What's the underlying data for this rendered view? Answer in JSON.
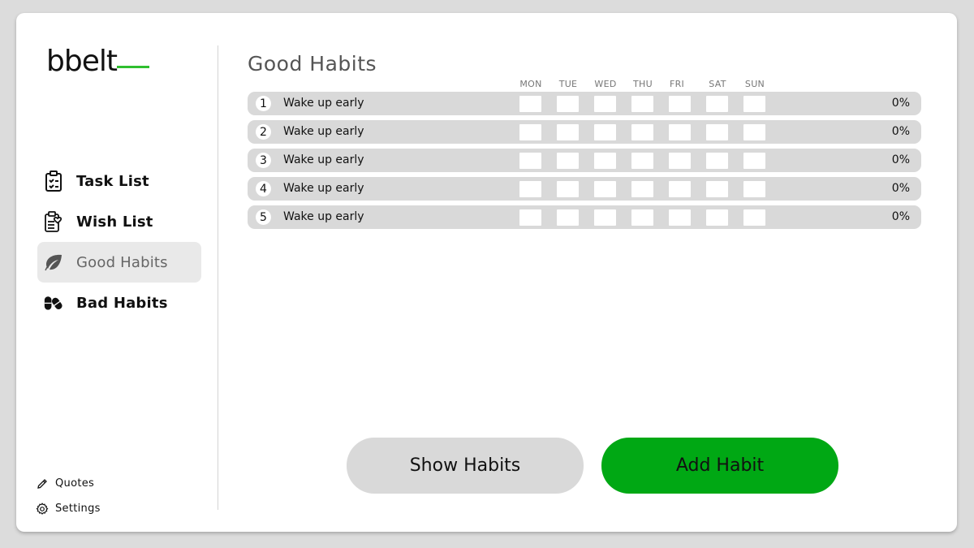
{
  "app": {
    "logo_text": "bbelt"
  },
  "sidebar": {
    "items": [
      {
        "label": "Task List",
        "icon": "clipboard-check-icon",
        "active": false
      },
      {
        "label": "Wish List",
        "icon": "clipboard-heart-icon",
        "active": false
      },
      {
        "label": "Good Habits",
        "icon": "leaf-icon",
        "active": true
      },
      {
        "label": "Bad Habits",
        "icon": "pills-icon",
        "active": false
      }
    ],
    "footer": [
      {
        "label": "Quotes",
        "icon": "pencil-icon"
      },
      {
        "label": "Settings",
        "icon": "gear-icon"
      }
    ]
  },
  "main": {
    "title": "Good Habits",
    "days": [
      "MON",
      "TUE",
      "WED",
      "THU",
      "FRI",
      "SAT",
      "SUN"
    ],
    "habits": [
      {
        "number": "1",
        "name": "Wake up early",
        "percent": "0%"
      },
      {
        "number": "2",
        "name": "Wake up early",
        "percent": "0%"
      },
      {
        "number": "3",
        "name": "Wake up early",
        "percent": "0%"
      },
      {
        "number": "4",
        "name": "Wake up early",
        "percent": "0%"
      },
      {
        "number": "5",
        "name": "Wake up early",
        "percent": "0%"
      }
    ],
    "buttons": {
      "show_label": "Show Habits",
      "add_label": "Add Habit"
    }
  },
  "colors": {
    "accent": "#00a814",
    "logo_accent": "#2fbf2f",
    "row_bg": "#d9d9d9",
    "background": "#dcdcdc"
  }
}
